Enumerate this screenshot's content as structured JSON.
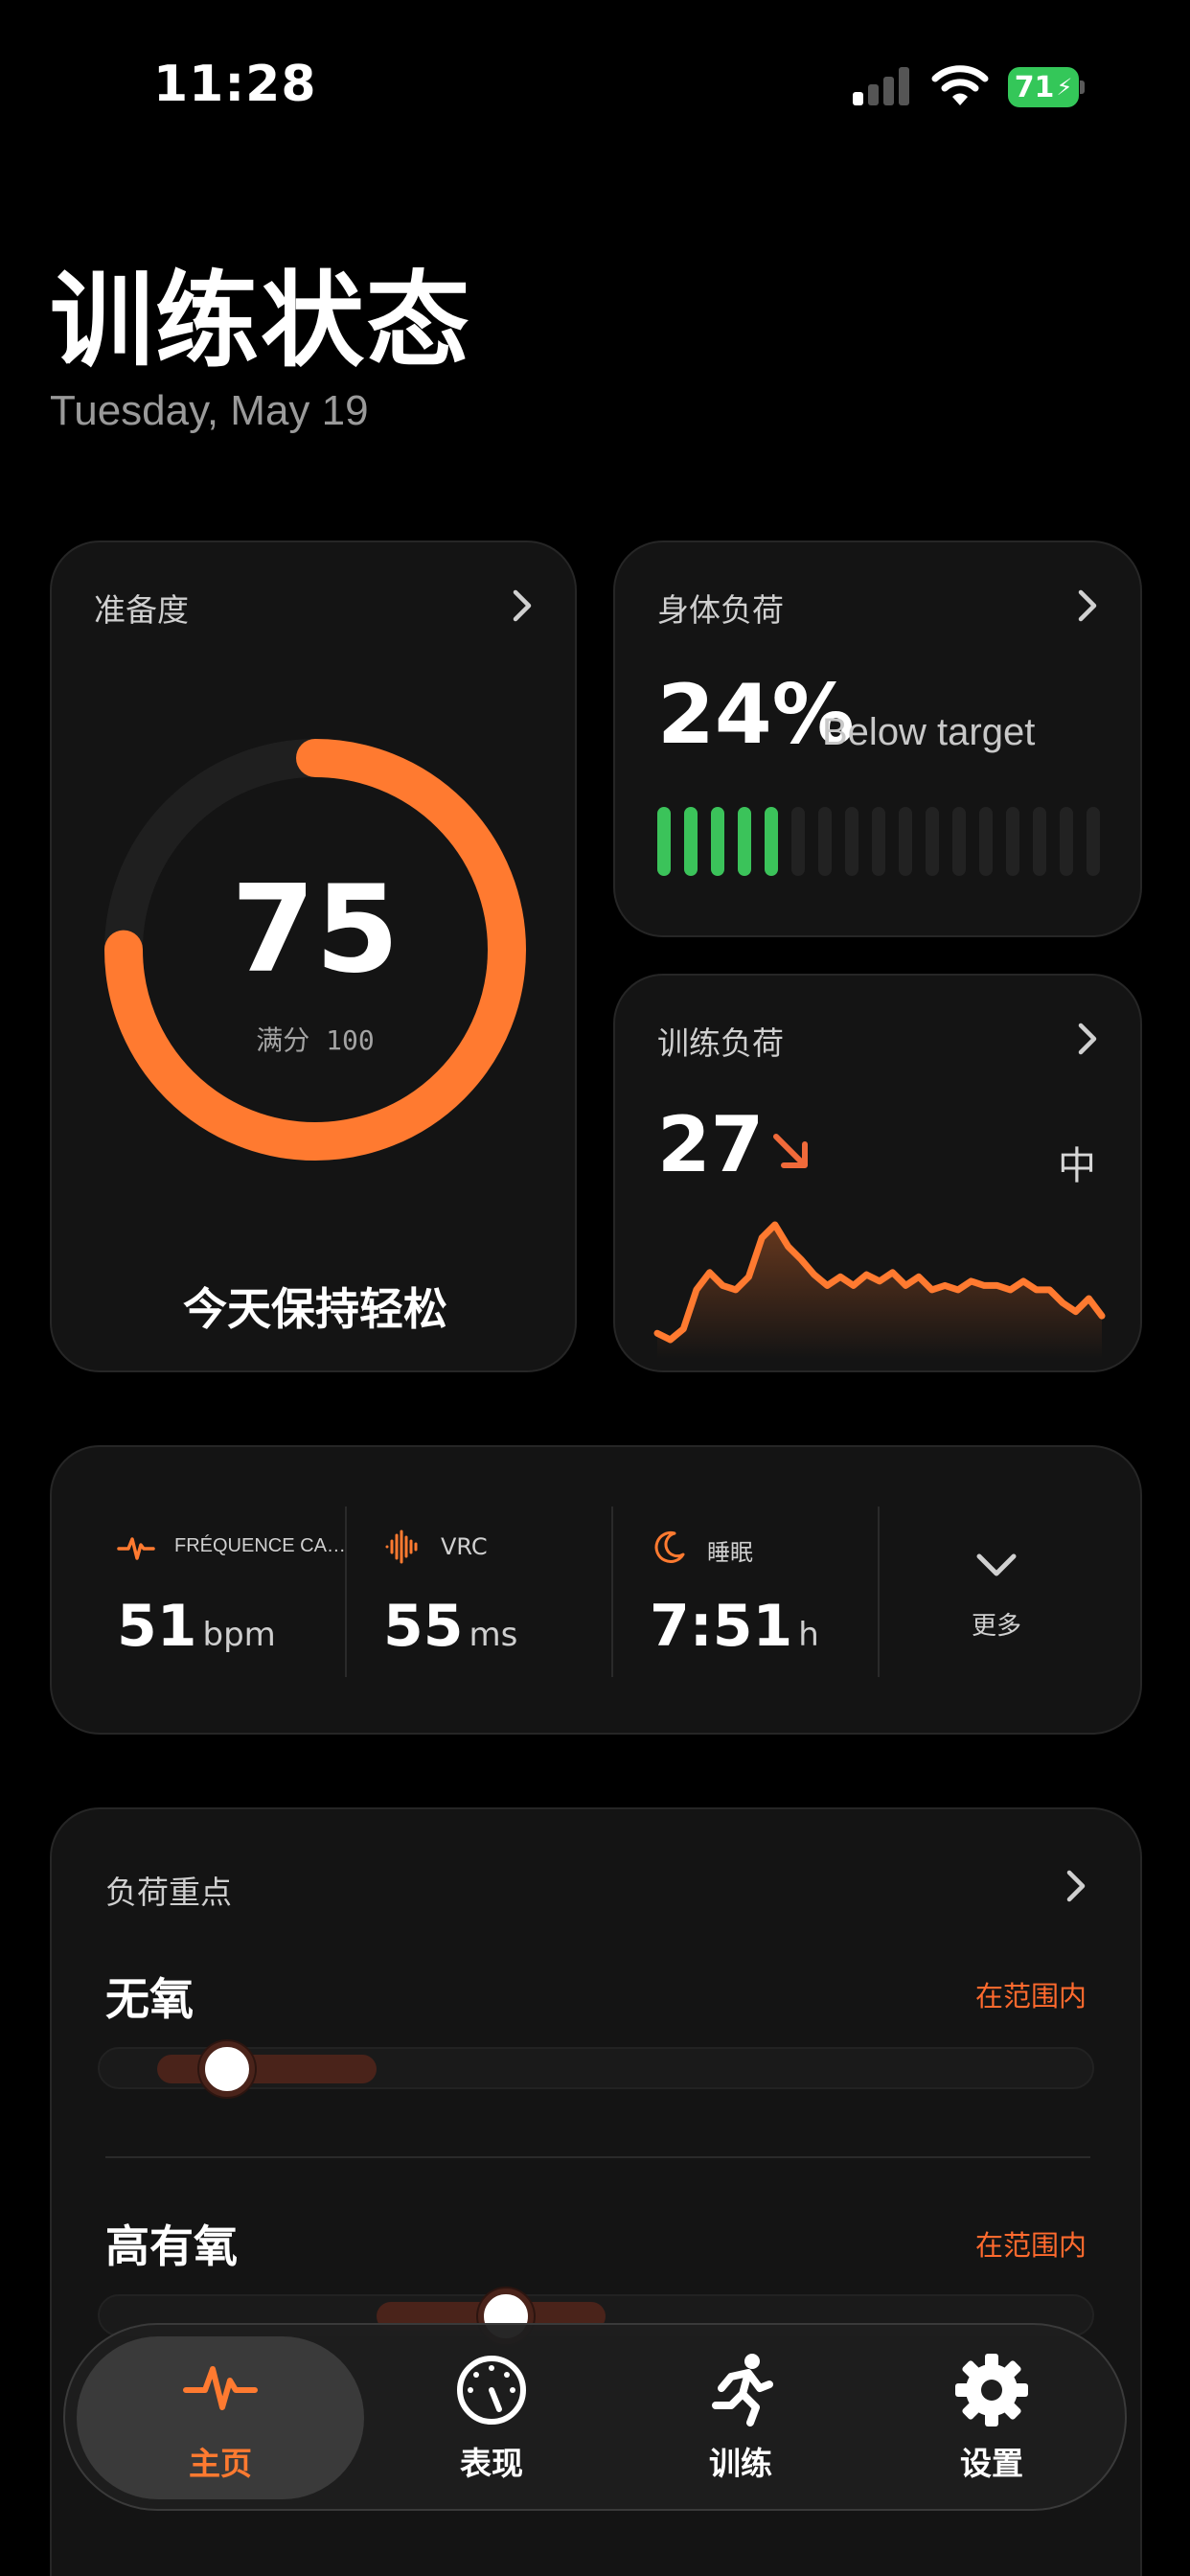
{
  "status_bar": {
    "time": "11:28",
    "battery": "71"
  },
  "header": {
    "title": "训练状态",
    "date": "Tuesday, May 19"
  },
  "readiness": {
    "label": "准备度",
    "score": "75",
    "max": "满分 100",
    "progress": 0.75,
    "message": "今天保持轻松"
  },
  "body_load": {
    "label": "身体负荷",
    "value": "24%",
    "note": "Below target",
    "filled_bars": 5,
    "total_bars": 17
  },
  "training_load": {
    "label": "训练负荷",
    "value": "27",
    "level": "中",
    "trend": [
      8,
      5,
      10,
      28,
      36,
      30,
      28,
      34,
      52,
      58,
      48,
      42,
      35,
      30,
      34,
      30,
      35,
      32,
      36,
      30,
      34,
      28,
      30,
      28,
      32,
      30,
      30,
      28,
      32,
      28,
      28,
      22,
      18,
      24,
      16
    ]
  },
  "vitals": {
    "heart_rate": {
      "label": "FRÉQUENCE CA…",
      "value": "51",
      "unit": "bpm"
    },
    "hrv": {
      "label": "VRC",
      "value": "55",
      "unit": "ms"
    },
    "sleep": {
      "label": "睡眠",
      "value": "7:51",
      "unit": "h"
    },
    "more_label": "更多"
  },
  "load_focus": {
    "title": "负荷重点",
    "zones": [
      {
        "name": "无氧",
        "status": "在范围内",
        "range": [
          0.0,
          0.22
        ],
        "value": 0.1
      },
      {
        "name": "高有氧",
        "status": "在范围内",
        "range": [
          0.22,
          0.45
        ],
        "value": 0.38
      }
    ]
  },
  "tabs": [
    {
      "label": "主页",
      "icon": "heart-pulse-icon",
      "active": true
    },
    {
      "label": "表现",
      "icon": "gauge-icon",
      "active": false
    },
    {
      "label": "训练",
      "icon": "running-figure-icon",
      "active": false
    },
    {
      "label": "设置",
      "icon": "gear-icon",
      "active": false
    }
  ],
  "colors": {
    "accent": "#ff7a30",
    "positive": "#3bc35a",
    "card": "#141414"
  }
}
